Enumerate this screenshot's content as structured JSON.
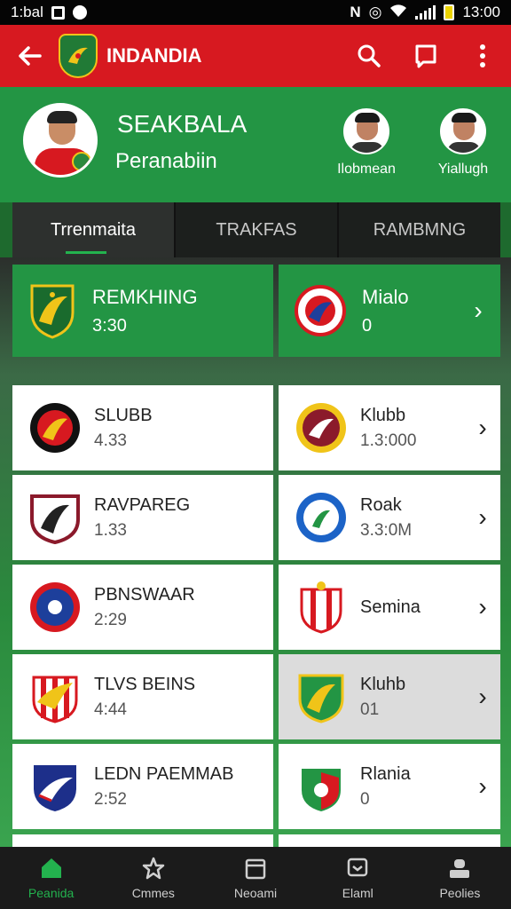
{
  "status_bar": {
    "time_left": "1:bal",
    "time_right": "13:00"
  },
  "app_bar": {
    "title": "INDANDIA"
  },
  "profile": {
    "name": "SEAKBALA",
    "subtitle": "Peranabiin",
    "friends": [
      {
        "name": "Ilobmean"
      },
      {
        "name": "Yiallugh"
      }
    ]
  },
  "tabs": [
    {
      "label": "Trrenmaita"
    },
    {
      "label": "TRAKFAS"
    },
    {
      "label": "RAMBMNG"
    }
  ],
  "stat_cards": [
    {
      "title": "REMKHING",
      "value": "3:30"
    },
    {
      "title": "Mialo",
      "value": "0"
    }
  ],
  "left_clubs": [
    {
      "name": "SLUBB",
      "value": "4.33",
      "colors": [
        "#111111",
        "#d71920"
      ]
    },
    {
      "name": "RAVPAREG",
      "value": "1.33",
      "colors": [
        "#ffffff",
        "#8b1a2b"
      ]
    },
    {
      "name": "PBNSWAAR",
      "value": "2:29",
      "colors": [
        "#1d3f9b",
        "#d71920"
      ]
    },
    {
      "name": "TLVS BEINS",
      "value": "4:44",
      "colors": [
        "#d71920",
        "#ffffff"
      ]
    },
    {
      "name": "LEDN PAEMMAB",
      "value": "2:52",
      "colors": [
        "#1d2f8a",
        "#ffffff"
      ]
    }
  ],
  "right_clubs": [
    {
      "name": "Klubb",
      "value": "1.3:000",
      "colors": [
        "#8b1a2b",
        "#f0c419"
      ]
    },
    {
      "name": "Roak",
      "value": "3.3:0M",
      "colors": [
        "#1c63c7",
        "#ffffff"
      ]
    },
    {
      "name": "Semina",
      "value": "",
      "colors": [
        "#d71920",
        "#ffffff"
      ]
    },
    {
      "name": "Kluhb",
      "value": "01",
      "colors": [
        "#239544",
        "#f0c419"
      ]
    },
    {
      "name": "Rlania",
      "value": "0",
      "colors": [
        "#d71920",
        "#239544"
      ]
    }
  ],
  "bottom_nav": [
    {
      "label": "Peanida",
      "icon": "home-icon"
    },
    {
      "label": "Cmmes",
      "icon": "star-icon"
    },
    {
      "label": "Neoami",
      "icon": "calendar-icon"
    },
    {
      "label": "Elaml",
      "icon": "message-icon"
    },
    {
      "label": "Peolies",
      "icon": "profile-icon"
    }
  ],
  "colors": {
    "app_bar": "#d71920",
    "green": "#239544",
    "accent": "#23b24e"
  }
}
